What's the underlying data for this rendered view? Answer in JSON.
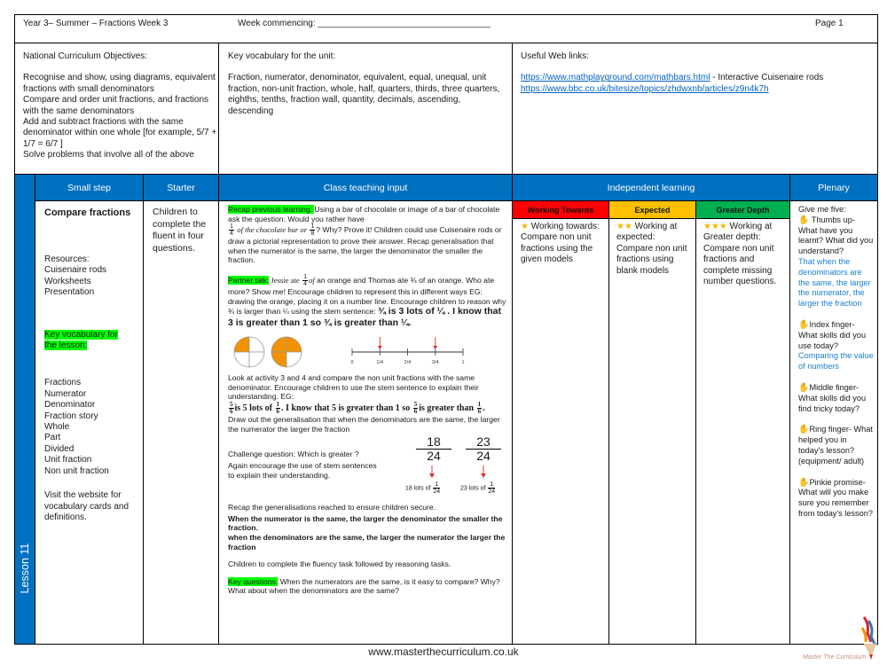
{
  "header": {
    "title": "Year 3– Summer – Fractions  Week 3",
    "week_commencing_label": "Week commencing: ___________________________________",
    "page_label": "Page 1"
  },
  "objectives": {
    "heading": "National Curriculum Objectives:",
    "lines": [
      "Recognise and show, using diagrams, equivalent fractions with small denominators",
      "Compare and order unit fractions, and fractions with the same denominators",
      "Add and subtract fractions with the same denominator within one whole [for example, 5/7 + 1/7 = 6/7 ]",
      "Solve problems that involve all of the above"
    ]
  },
  "vocab_unit": {
    "heading": "Key vocabulary for the unit:",
    "text": "Fraction, numerator, denominator, equivalent,  equal, unequal, unit fraction, non-unit fraction, whole, half, quarters, thirds, three quarters, eighths, tenths, fraction wall, quantity, decimals, ascending, descending"
  },
  "web_links": {
    "heading": "Useful Web links:",
    "link1": "https://www.mathplayground.com/mathbars.html",
    "link1_suffix": " - Interactive Cuisenaire rods",
    "link2": "https://www.bbc.co.uk/bitesize/topics/zhdwxnb/articles/z9n4k7h"
  },
  "columns": {
    "small_step": "Small step",
    "starter": "Starter",
    "class_teaching": "Class teaching input",
    "independent": "Independent learning",
    "plenary": "Plenary",
    "working_towards": "Working Towards",
    "expected": "Expected",
    "greater_depth": "Greater Depth"
  },
  "colors": {
    "blue": "#0070c0",
    "working_towards": "#ff0000",
    "expected": "#ffc000",
    "greater_depth": "#00b050",
    "highlight": "#00ff00",
    "orange": "#f39200"
  },
  "lesson_label": "Lesson 11",
  "small_step": {
    "title": "Compare fractions",
    "resources_heading": "Resources:",
    "resources": [
      "Cuisenaire rods",
      "Worksheets",
      "Presentation"
    ],
    "vocab_heading": "Key vocabulary for the lesson:",
    "vocab": [
      "Fractions",
      "Numerator",
      "Denominator",
      "Fraction story",
      "Whole",
      "Part",
      "Divided",
      "Unit fraction",
      "Non unit fraction"
    ],
    "visit_text": "Visit the website for vocabulary cards and definitions."
  },
  "starter": {
    "text": "Children to complete the fluent in four questions."
  },
  "teaching": {
    "recap_label": "Recap previous learning: ",
    "recap_text_1": " Using a bar of chocolate or image of a  bar of chocolate ask the question:  Would you rather have",
    "recap_of_choc": "of the chocolate bar or",
    "recap_text_2": "?  Why? Prove it!  Children could use Cuisenaire rods or draw a pictorial representation  to prove their answer.  Recap generalisation that when the numerator is the same, the larger the denominator the smaller the fraction.",
    "frac_1_4": {
      "n": "1",
      "d": "4"
    },
    "frac_1_8": {
      "n": "1",
      "d": "8"
    },
    "partner_label": "Partner talk:",
    "partner_text_1": " Jessie ate",
    "partner_of": "of",
    "partner_text_2": " an orange and Thomas ate ¾ of an orange.  Who ate more?  Show me!  Encourage children to represent  this in different ways EG: drawing the orange, placing it on a number line.  Encourage children to reason  why ¾ is larger than ¼ using the  stem sentence: ",
    "partner_stem": "¾ is 3 lots of ¼ . I know that 3 is greater than 1 so ¾ is greater than ¼.",
    "numberline_ticks": [
      "0",
      "1/4",
      "2/4",
      "3/4",
      "1"
    ],
    "numberline_arrows_at": [
      "1/4",
      "3/4"
    ],
    "circles_shaded_quarters": [
      1,
      3
    ],
    "activity_text": "Look at activity 3 and  4  and compare the non unit  fractions with the same denominator.  Encourage children to use the stem sentence to explain their understanding.  EG:",
    "stem2_a": "is 5 lots of",
    "stem2_b": ". I know that 5 is greater than 1 so",
    "stem2_c": "is greater than",
    "frac_5_6": {
      "n": "5",
      "d": "6"
    },
    "frac_1_6": {
      "n": "1",
      "d": "6"
    },
    "draw_out_text": "Draw out the generalisation that when the denominators are the same, the larger the numerator the larger the fraction",
    "challenge_q": "Challenge question:  Which is greater ?",
    "challenge_text": "Again encourage the use of stem sentences to explain their understanding.",
    "challenge_fracs": [
      {
        "n": "18",
        "d": "24",
        "label": "18 lots of",
        "unit_n": "1",
        "unit_d": "24"
      },
      {
        "n": "23",
        "d": "24",
        "label": "23 lots of",
        "unit_n": "1",
        "unit_d": "24"
      }
    ],
    "recap_gen": "Recap the generalisations reached to ensure children secure.",
    "gen_bold_1": "When the numerator is the same, the larger the denominator the smaller the fraction.",
    "gen_bold_2": "when the denominators are the same, the larger the numerator the larger the fraction",
    "fluency_text": "Children to complete the fluency task followed by reasoning tasks.",
    "key_q_label": "Key questions:",
    "key_q_text": " When the numerators are the same, is it easy to compare? Why?  What about when the denominators are the same?"
  },
  "independent": {
    "working_towards": {
      "stars": "★",
      "lead": " Working towards:",
      "text": "Compare non unit fractions using the given models"
    },
    "expected": {
      "stars": "★★",
      "lead": " Working at expected:",
      "text": "Compare non unit fractions using blank models"
    },
    "greater_depth": {
      "stars": "★★★",
      "lead": " Working at Greater depth:",
      "text": "Compare non unit fractions and complete missing number questions."
    }
  },
  "plenary": {
    "intro": "Give me five:",
    "items": [
      {
        "icon": "✋",
        "label": " Thumbs up- What have you learnt? What did you understand?",
        "answer": "That when the denominators are the same, the larger the numerator, the larger the fraction"
      },
      {
        "icon": "✋",
        "label": "Index finger- What skills did you use today?",
        "answer": "Comparing the value of numbers"
      },
      {
        "icon": "✋",
        "label": "Middle finger- What skills did you find tricky today?",
        "answer": ""
      },
      {
        "icon": "✋",
        "label": "Ring finger- What helped you in today's lesson? (equipment/ adult)",
        "answer": ""
      },
      {
        "icon": "✋",
        "label": "Pinkie promise- What will you make sure you remember from today's lesson?",
        "answer": ""
      }
    ]
  },
  "footer": {
    "website": "www.masterthecurriculum.co.uk",
    "logo_text": "Master  The  Curriculum"
  }
}
